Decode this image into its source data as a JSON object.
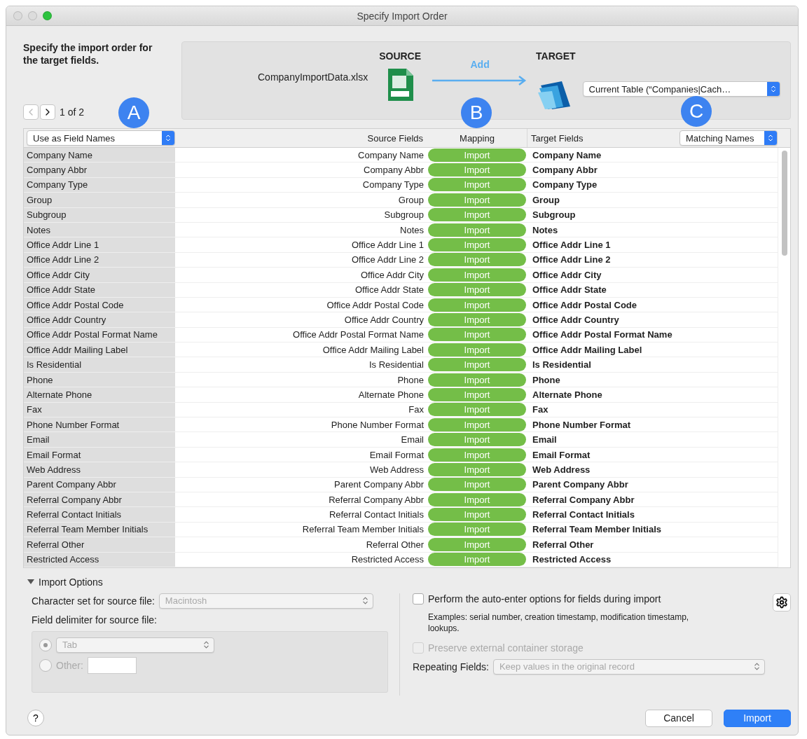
{
  "window": {
    "title": "Specify Import Order"
  },
  "instructions": "Specify the import order for the target fields.",
  "source": {
    "heading": "SOURCE",
    "file": "CompanyImportData.xlsx"
  },
  "arrow_label": "Add",
  "target": {
    "heading": "TARGET",
    "table": "Current Table (“Companies|Cach…"
  },
  "pager": {
    "text": "1 of 2",
    "prev_disabled": true,
    "next_disabled": false
  },
  "table": {
    "field_names_menu": "Use as Field Names",
    "columns": [
      "Source Fields",
      "Mapping",
      "Target Fields"
    ],
    "match_menu": "Matching Names",
    "rows": [
      {
        "field": "Company Name",
        "source": "Company Name",
        "mapping": "Import",
        "target": "Company Name"
      },
      {
        "field": "Company Abbr",
        "source": "Company Abbr",
        "mapping": "Import",
        "target": "Company Abbr"
      },
      {
        "field": "Company Type",
        "source": "Company Type",
        "mapping": "Import",
        "target": "Company Type"
      },
      {
        "field": "Group",
        "source": "Group",
        "mapping": "Import",
        "target": "Group"
      },
      {
        "field": "Subgroup",
        "source": "Subgroup",
        "mapping": "Import",
        "target": "Subgroup"
      },
      {
        "field": "Notes",
        "source": "Notes",
        "mapping": "Import",
        "target": "Notes"
      },
      {
        "field": "Office Addr Line 1",
        "source": "Office Addr Line 1",
        "mapping": "Import",
        "target": "Office Addr Line 1"
      },
      {
        "field": "Office Addr Line 2",
        "source": "Office Addr Line 2",
        "mapping": "Import",
        "target": "Office Addr Line 2"
      },
      {
        "field": "Office Addr City",
        "source": "Office Addr City",
        "mapping": "Import",
        "target": "Office Addr City"
      },
      {
        "field": "Office Addr State",
        "source": "Office Addr State",
        "mapping": "Import",
        "target": "Office Addr State"
      },
      {
        "field": "Office Addr Postal Code",
        "source": "Office Addr Postal Code",
        "mapping": "Import",
        "target": "Office Addr Postal Code"
      },
      {
        "field": "Office Addr Country",
        "source": "Office Addr Country",
        "mapping": "Import",
        "target": "Office Addr Country"
      },
      {
        "field": "Office Addr Postal Format Name",
        "source": "Office Addr Postal Format Name",
        "mapping": "Import",
        "target": "Office Addr Postal Format Name"
      },
      {
        "field": "Office Addr Mailing Label",
        "source": "Office Addr Mailing Label",
        "mapping": "Import",
        "target": "Office Addr Mailing Label"
      },
      {
        "field": "Is Residential",
        "source": "Is Residential",
        "mapping": "Import",
        "target": "Is Residential"
      },
      {
        "field": "Phone",
        "source": "Phone",
        "mapping": "Import",
        "target": "Phone"
      },
      {
        "field": "Alternate Phone",
        "source": "Alternate Phone",
        "mapping": "Import",
        "target": "Alternate Phone"
      },
      {
        "field": "Fax",
        "source": "Fax",
        "mapping": "Import",
        "target": "Fax"
      },
      {
        "field": "Phone Number Format",
        "source": "Phone Number Format",
        "mapping": "Import",
        "target": "Phone Number Format"
      },
      {
        "field": "Email",
        "source": "Email",
        "mapping": "Import",
        "target": "Email"
      },
      {
        "field": "Email Format",
        "source": "Email Format",
        "mapping": "Import",
        "target": "Email Format"
      },
      {
        "field": "Web Address",
        "source": "Web Address",
        "mapping": "Import",
        "target": "Web Address"
      },
      {
        "field": "Parent Company Abbr",
        "source": "Parent Company Abbr",
        "mapping": "Import",
        "target": "Parent Company Abbr"
      },
      {
        "field": "Referral Company Abbr",
        "source": "Referral Company Abbr",
        "mapping": "Import",
        "target": "Referral Company Abbr"
      },
      {
        "field": "Referral Contact Initials",
        "source": "Referral Contact Initials",
        "mapping": "Import",
        "target": "Referral Contact Initials"
      },
      {
        "field": "Referral Team Member Initials",
        "source": "Referral Team Member Initials",
        "mapping": "Import",
        "target": "Referral Team Member Initials"
      },
      {
        "field": "Referral Other",
        "source": "Referral Other",
        "mapping": "Import",
        "target": "Referral Other"
      },
      {
        "field": "Restricted Access",
        "source": "Restricted Access",
        "mapping": "Import",
        "target": "Restricted Access"
      }
    ]
  },
  "callouts": [
    "A",
    "B",
    "C"
  ],
  "import_options": {
    "title": "Import Options",
    "expanded": true,
    "charset_label": "Character set for source file:",
    "charset": "Macintosh",
    "delimiter_label": "Field delimiter for source file:",
    "delimiter_options": [
      {
        "kind": "menu",
        "value": "Tab",
        "selected": true
      },
      {
        "kind": "field",
        "label": "Other:",
        "selected": false
      }
    ],
    "auto_enter": {
      "label": "Perform the auto-enter options for fields during import",
      "checked": false,
      "note": "Examples: serial number, creation timestamp, modification timestamp, lookups."
    },
    "preserve": {
      "label": "Preserve external container storage",
      "checked": false,
      "disabled": true
    },
    "repeating_label": "Repeating Fields:",
    "repeating": "Keep values in the original record"
  },
  "help": "?",
  "buttons": [
    {
      "label": "Cancel",
      "default": false
    },
    {
      "label": "Import",
      "default": true
    }
  ]
}
